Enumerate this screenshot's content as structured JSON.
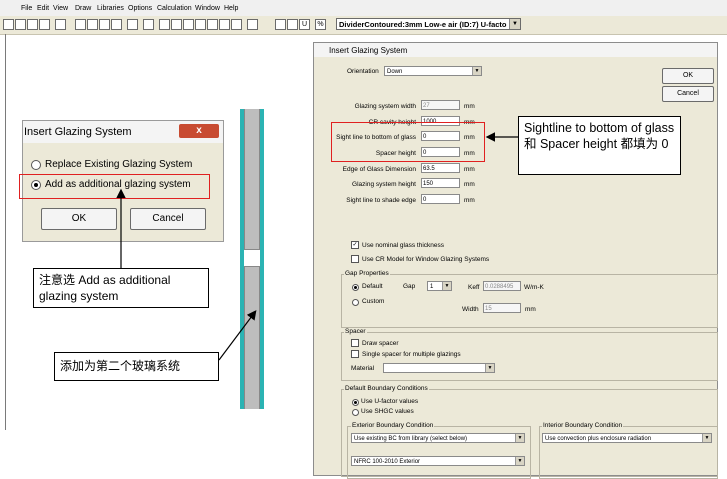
{
  "menu": [
    "File",
    "Edit",
    "View",
    "Draw",
    "Libraries",
    "Options",
    "Calculation",
    "Window",
    "Help"
  ],
  "toolbar": {
    "tools": [
      "new",
      "open",
      "save",
      "print",
      "view",
      "select",
      "rect",
      "poly",
      "zoom",
      "pen",
      "wand",
      "fill",
      "u",
      "percent",
      "glaze"
    ],
    "u_label": "U",
    "percent_label": "%",
    "combo_value": "DividerContoured:3mm Low-e air (ID:7) U-facto"
  },
  "small_dialog": {
    "title": "Insert Glazing System",
    "close_label": "x",
    "option_replace": "Replace Existing Glazing System",
    "option_add": "Add as additional glazing system",
    "ok_label": "OK",
    "cancel_label": "Cancel"
  },
  "callouts": {
    "add_note": "注意选 Add as additional glazing system",
    "second_glazing": "添加为第二个玻璃系统",
    "sightline_note": "Sightline to bottom of glass 和 Spacer height 都填为 0"
  },
  "main_dialog": {
    "title": "Insert Glazing System",
    "orientation_label": "Orientation",
    "orientation_value": "Down",
    "ok_label": "OK",
    "cancel_label": "Cancel",
    "fields": [
      {
        "label": "Glazing system width",
        "value": "27",
        "unit": "mm",
        "disabled": true
      },
      {
        "label": "CR cavity height",
        "value": "1000",
        "unit": "mm",
        "disabled": false
      },
      {
        "label": "Sight line to bottom of glass",
        "value": "0",
        "unit": "mm",
        "disabled": false
      },
      {
        "label": "Spacer height",
        "value": "0",
        "unit": "mm",
        "disabled": false
      },
      {
        "label": "Edge of Glass Dimension",
        "value": "63.5",
        "unit": "mm",
        "disabled": false
      },
      {
        "label": "Glazing system height",
        "value": "150",
        "unit": "mm",
        "disabled": false
      },
      {
        "label": "Sight line to shade edge",
        "value": "0",
        "unit": "mm",
        "disabled": false
      }
    ],
    "use_nominal_thickness": "Use nominal glass thickness",
    "use_cr_model": "Use CR Model for Window Glazing Systems",
    "gap_properties": {
      "title": "Gap Properties",
      "default_label": "Default",
      "gap_label": "Gap",
      "gap_value": "1",
      "keff_label": "Keff",
      "keff_value": "0.0288495",
      "keff_unit": "W/m-K",
      "custom_label": "Custom",
      "width_label": "Width",
      "width_value": "15",
      "width_unit": "mm"
    },
    "spacer": {
      "title": "Spacer",
      "draw_spacer": "Draw spacer",
      "single_spacer": "Single spacer for multiple glazings",
      "material_label": "Material",
      "material_value": ""
    },
    "boundary": {
      "title": "Default Boundary Conditions",
      "use_ufactor": "Use U-factor values",
      "use_shgc": "Use SHGC values",
      "exterior_title": "Exterior Boundary Condition",
      "exterior_value": "Use existing BC from library (select below)",
      "exterior_library": "NFRC 100-2010 Exterior",
      "interior_title": "Interior Boundary Condition",
      "interior_value": "Use convection plus enclosure radiation"
    }
  }
}
